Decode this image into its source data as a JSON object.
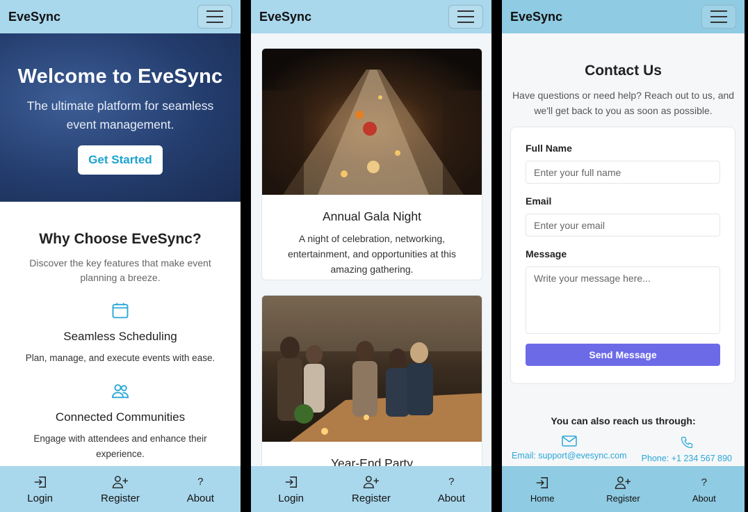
{
  "screens": {
    "home": {
      "brand": "EveSync",
      "hero": {
        "title": "Welcome to EveSync",
        "subtitle": "The ultimate platform for seamless event management.",
        "cta": "Get Started"
      },
      "why": {
        "title": "Why Choose EveSync?",
        "subtitle": "Discover the key features that make event planning a breeze.",
        "features": [
          {
            "icon": "calendar-icon",
            "title": "Seamless Scheduling",
            "text": "Plan, manage, and execute events with ease."
          },
          {
            "icon": "users-icon",
            "title": "Connected Communities",
            "text": "Engage with attendees and enhance their experience."
          }
        ]
      },
      "bottom_nav": [
        {
          "icon": "login-icon",
          "label": "Login"
        },
        {
          "icon": "user-plus-icon",
          "label": "Register"
        },
        {
          "icon": "question-icon",
          "label": "About",
          "glyph": "?"
        }
      ]
    },
    "events": {
      "brand": "EveSync",
      "cards": [
        {
          "title": "Annual Gala Night",
          "text": "A night of celebration, networking, entertainment, and opportunities at this amazing gathering."
        },
        {
          "title": "Year-End Party",
          "text": ""
        }
      ],
      "bottom_nav": [
        {
          "icon": "login-icon",
          "label": "Login"
        },
        {
          "icon": "user-plus-icon",
          "label": "Register"
        },
        {
          "icon": "question-icon",
          "label": "About",
          "glyph": "?"
        }
      ]
    },
    "contact": {
      "brand": "EveSync",
      "title": "Contact Us",
      "subtitle": "Have questions or need help? Reach out to us, and we'll get back to you as soon as possible.",
      "form": {
        "name_label": "Full Name",
        "name_placeholder": "Enter your full name",
        "email_label": "Email",
        "email_placeholder": "Enter your email",
        "message_label": "Message",
        "message_placeholder": "Write your message here...",
        "submit": "Send Message"
      },
      "reach_title": "You can also reach us through:",
      "email_link": "Email: support@evesync.com",
      "phone_link": "Phone: +1 234 567 890",
      "bottom_nav": [
        {
          "icon": "login-icon",
          "label": "Home"
        },
        {
          "icon": "user-plus-icon",
          "label": "Register"
        },
        {
          "icon": "question-icon",
          "label": "About",
          "glyph": "?"
        }
      ]
    }
  },
  "colors": {
    "navbar": "#a9d7ec",
    "accent": "#1aa3d1",
    "button": "#6d6ae8",
    "hero": "#243d6e"
  }
}
